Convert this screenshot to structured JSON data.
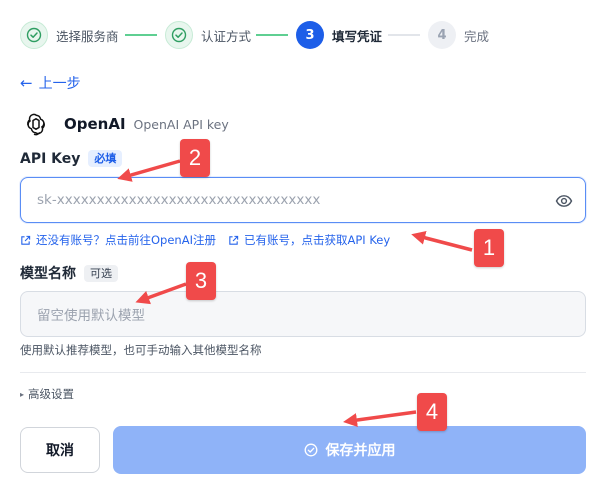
{
  "stepper": {
    "steps": [
      {
        "label": "选择服务商",
        "state": "done"
      },
      {
        "label": "认证方式",
        "state": "done"
      },
      {
        "label": "填写凭证",
        "state": "active",
        "number": "3"
      },
      {
        "label": "完成",
        "state": "pending",
        "number": "4"
      }
    ]
  },
  "back": {
    "label": "上一步"
  },
  "provider": {
    "name": "OpenAI",
    "description": "OpenAI API key"
  },
  "api_key": {
    "label": "API Key",
    "tag": "必填",
    "placeholder": "sk-xxxxxxxxxxxxxxxxxxxxxxxxxxxxxxxxx",
    "link_register": "还没有账号？点击前往OpenAI注册",
    "link_get_key": "已有账号，点击获取API Key"
  },
  "model": {
    "label": "模型名称",
    "tag": "可选",
    "placeholder": "留空使用默认模型",
    "hint": "使用默认推荐模型，也可手动输入其他模型名称"
  },
  "advanced": {
    "label": "高级设置"
  },
  "actions": {
    "cancel": "取消",
    "save": "保存并应用"
  },
  "annotations": [
    "1",
    "2",
    "3",
    "4"
  ],
  "colors": {
    "primary": "#1d5ee8",
    "done_green": "#5fcf92",
    "save_button": "#8fb3f8",
    "annotation_red": "#f04a4a"
  }
}
